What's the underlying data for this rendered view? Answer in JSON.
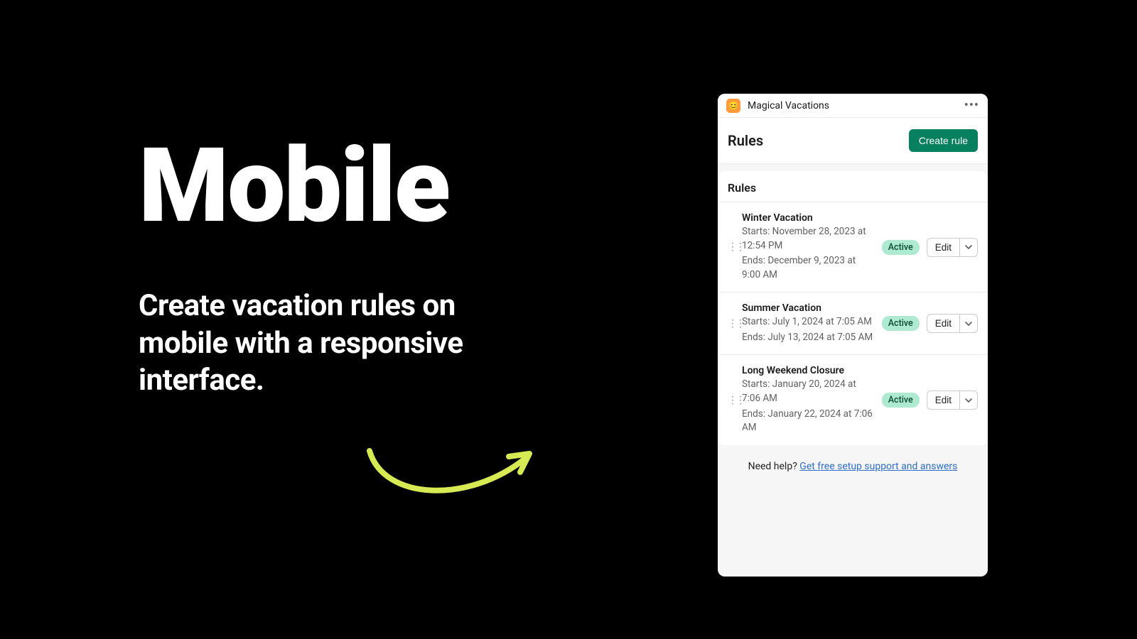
{
  "hero": {
    "title": "Mobile",
    "subtitle": "Create vacation rules on mobile with a responsive interface."
  },
  "colors": {
    "accent_arrow": "#d7ea53",
    "primary_button": "#078060",
    "badge_bg": "#aee9d1"
  },
  "app": {
    "name": "Magical Vacations",
    "header_title": "Rules",
    "create_button": "Create rule",
    "section_title": "Rules",
    "status_label": "Active",
    "edit_label": "Edit",
    "rules": [
      {
        "title": "Winter Vacation",
        "starts": "Starts: November 28, 2023 at 12:54 PM",
        "ends": "Ends: December 9, 2023 at 9:00 AM"
      },
      {
        "title": "Summer Vacation",
        "starts": "Starts: July 1, 2024 at 7:05 AM",
        "ends": "Ends: July 13, 2024 at 7:05 AM"
      },
      {
        "title": "Long Weekend Closure",
        "starts": "Starts: January 20, 2024 at 7:06 AM",
        "ends": "Ends: January 22, 2024 at 7:06 AM"
      }
    ],
    "help_prefix": "Need help? ",
    "help_link": "Get free setup support and answers"
  }
}
